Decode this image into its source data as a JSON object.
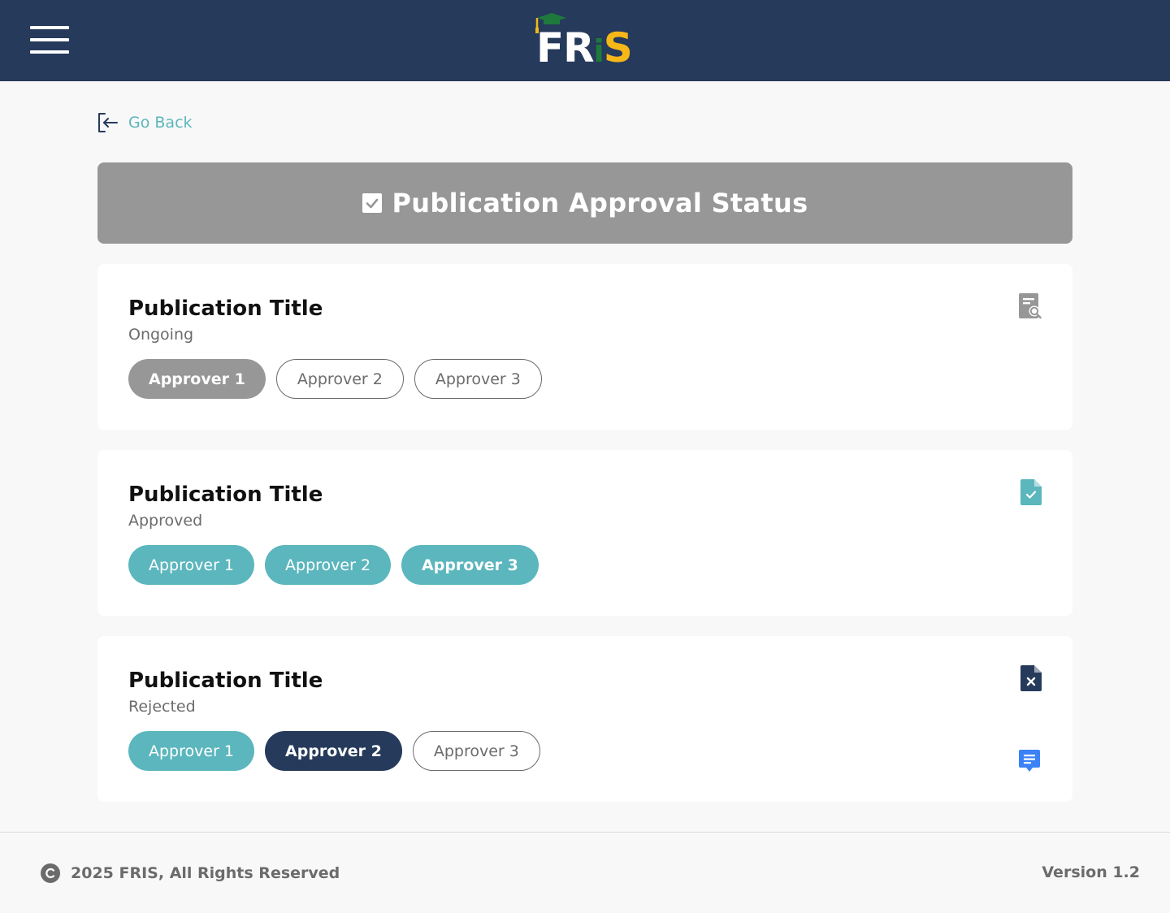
{
  "header": {
    "logo_text": "FRIS",
    "logo_parts": [
      "FR",
      "i",
      "S"
    ],
    "brand_colors": {
      "navy": "#263a5b",
      "green": "#1e7a3c",
      "yellow": "#f5b818"
    },
    "menu_icon": "hamburger-menu-icon"
  },
  "nav": {
    "go_back_label": "Go Back",
    "go_back_icon": "sign-out-arrow-left-icon"
  },
  "banner": {
    "title": "Publication Approval Status",
    "icon": "checkbox-checked-icon",
    "background": "#979797"
  },
  "publications": [
    {
      "title": "Publication Title",
      "status": "Ongoing",
      "status_icon": "document-search-icon",
      "approvers": [
        {
          "label": "Approver 1",
          "state": "active"
        },
        {
          "label": "Approver 2",
          "state": "pending"
        },
        {
          "label": "Approver 3",
          "state": "pending"
        }
      ]
    },
    {
      "title": "Publication Title",
      "status": "Approved",
      "status_icon": "document-check-icon",
      "approvers": [
        {
          "label": "Approver 1",
          "state": "approved"
        },
        {
          "label": "Approver 2",
          "state": "approved"
        },
        {
          "label": "Approver 3",
          "state": "approved-final"
        }
      ]
    },
    {
      "title": "Publication Title",
      "status": "Rejected",
      "status_icon": "document-x-icon",
      "comment_icon": "comment-message-icon",
      "approvers": [
        {
          "label": "Approver 1",
          "state": "approved"
        },
        {
          "label": "Approver 2",
          "state": "rejected"
        },
        {
          "label": "Approver 3",
          "state": "pending"
        }
      ]
    }
  ],
  "footer": {
    "copyright_text": "2025 FRIS, All Rights Reserved",
    "copyright_icon": "copyright-icon",
    "version": "Version 1.2"
  },
  "colors": {
    "accent_teal": "#5bb6bd",
    "navy": "#263a5b",
    "gray": "#979797",
    "text_gray": "#6b6b6b",
    "comment_blue": "#3b82f6"
  }
}
